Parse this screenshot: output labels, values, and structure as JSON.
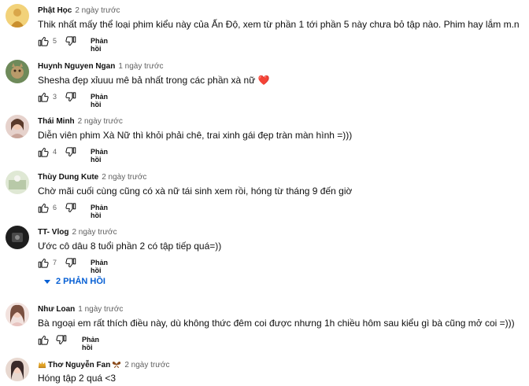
{
  "comments": [
    {
      "author": "Phật Học",
      "time": "2 ngày trước",
      "text": "Thik nhất mấy thể loại phim kiểu này của Ấn Độ, xem từ phần 1 tới phần 5 này chưa bỏ tập nào. Phim hay lắm m.n",
      "likes": "5",
      "reply_label": "Phản hồi",
      "avatar_color": "#d9a64a"
    },
    {
      "author": "Huynh Nguyen Ngan",
      "time": "1 ngày trước",
      "text": "Shesha đẹp xỉuuu mê bả nhất trong các phần xà nữ",
      "heart": "❤️",
      "likes": "3",
      "reply_label": "Phản hồi",
      "avatar_color": "#8a7a5a"
    },
    {
      "author": "Thái Minh",
      "time": "2 ngày trước",
      "text": "Diễn viên phim Xà Nữ thì khỏi phải chê, trai xinh gái đẹp tràn màn hình =)))",
      "likes": "4",
      "reply_label": "Phản hồi",
      "avatar_color": "#c9a59a"
    },
    {
      "author": "Thùy Dung Kute",
      "time": "2 ngày trước",
      "text": "Chờ mãi cuối cùng cũng có xà nữ tái sinh xem rồi, hóng từ tháng 9 đến giờ",
      "likes": "6",
      "reply_label": "Phản hồi",
      "avatar_color": "#b8c9a8"
    },
    {
      "author": "TT- Vlog",
      "time": "2 ngày trước",
      "text": "Ước cô dâu 8 tuổi phần 2 có tập tiếp quá=))",
      "likes": "7",
      "reply_label": "Phản hồi",
      "avatar_color": "#2b2b2b"
    },
    {
      "author": "Như Loan",
      "time": "1 ngày trước",
      "text": "Bà ngoại em rất thích điều này, dù không thức đêm coi được nhưng 1h chiều hôm sau kiểu gì bà cũng mở coi =)))",
      "likes": "",
      "reply_label": "Phản hồi",
      "avatar_color": "#e8c4c0"
    },
    {
      "author": "Thơ Nguyễn Fan",
      "time": "2 ngày trước",
      "text": "Hóng tập 2 quá <3",
      "likes": "",
      "reply_label": "",
      "avatar_color": "#c98a7a"
    }
  ],
  "replies_toggle": "2 PHẢN HỒI",
  "accent": "#065fd4"
}
